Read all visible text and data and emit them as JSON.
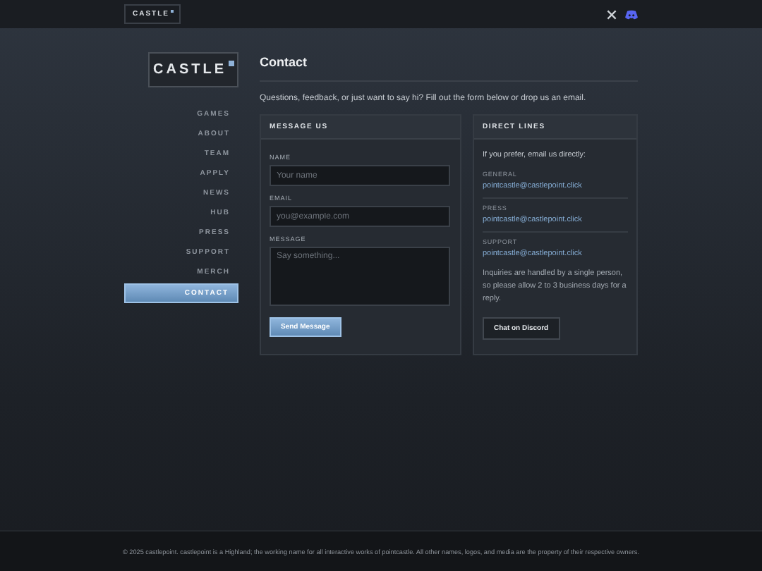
{
  "topbar": {
    "logo": "CASTLE"
  },
  "sidebar": {
    "logo": "CASTLE",
    "items": [
      {
        "label": "GAMES",
        "selected": false
      },
      {
        "label": "ABOUT",
        "selected": false
      },
      {
        "label": "TEAM",
        "selected": false
      },
      {
        "label": "APPLY",
        "selected": false
      },
      {
        "label": "NEWS",
        "selected": false
      },
      {
        "label": "HUB",
        "selected": false
      },
      {
        "label": "PRESS",
        "selected": false
      },
      {
        "label": "SUPPORT",
        "selected": false
      },
      {
        "label": "MERCH",
        "selected": false
      },
      {
        "label": "CONTACT",
        "selected": true
      }
    ]
  },
  "page": {
    "title": "Contact",
    "intro": "Questions, feedback, or just want to say hi? Fill out the form below or drop us an email."
  },
  "message_panel": {
    "title": "MESSAGE US",
    "fields": [
      {
        "label": "NAME",
        "placeholder": "Your name",
        "kind": "input"
      },
      {
        "label": "EMAIL",
        "placeholder": "you@example.com",
        "kind": "input"
      },
      {
        "label": "MESSAGE",
        "placeholder": "Say something...",
        "kind": "textarea"
      }
    ],
    "button": "Send Message"
  },
  "direct_panel": {
    "title": "DIRECT LINES",
    "intro": "If you prefer, email us directly:",
    "lines": [
      {
        "label": "GENERAL",
        "email": "pointcastle@castlepoint.click"
      },
      {
        "label": "PRESS",
        "email": "pointcastle@castlepoint.click"
      },
      {
        "label": "SUPPORT",
        "email": "pointcastle@castlepoint.click"
      }
    ],
    "note": "Inquiries are handled by a single person, so please allow 2 to 3 business days for a reply.",
    "button": "Chat on Discord"
  },
  "footer": "© 2025 castlepoint. castlepoint is a Highland; the working name for all interactive works of pointcastle. All other names, logos, and media are the property of their respective owners."
}
